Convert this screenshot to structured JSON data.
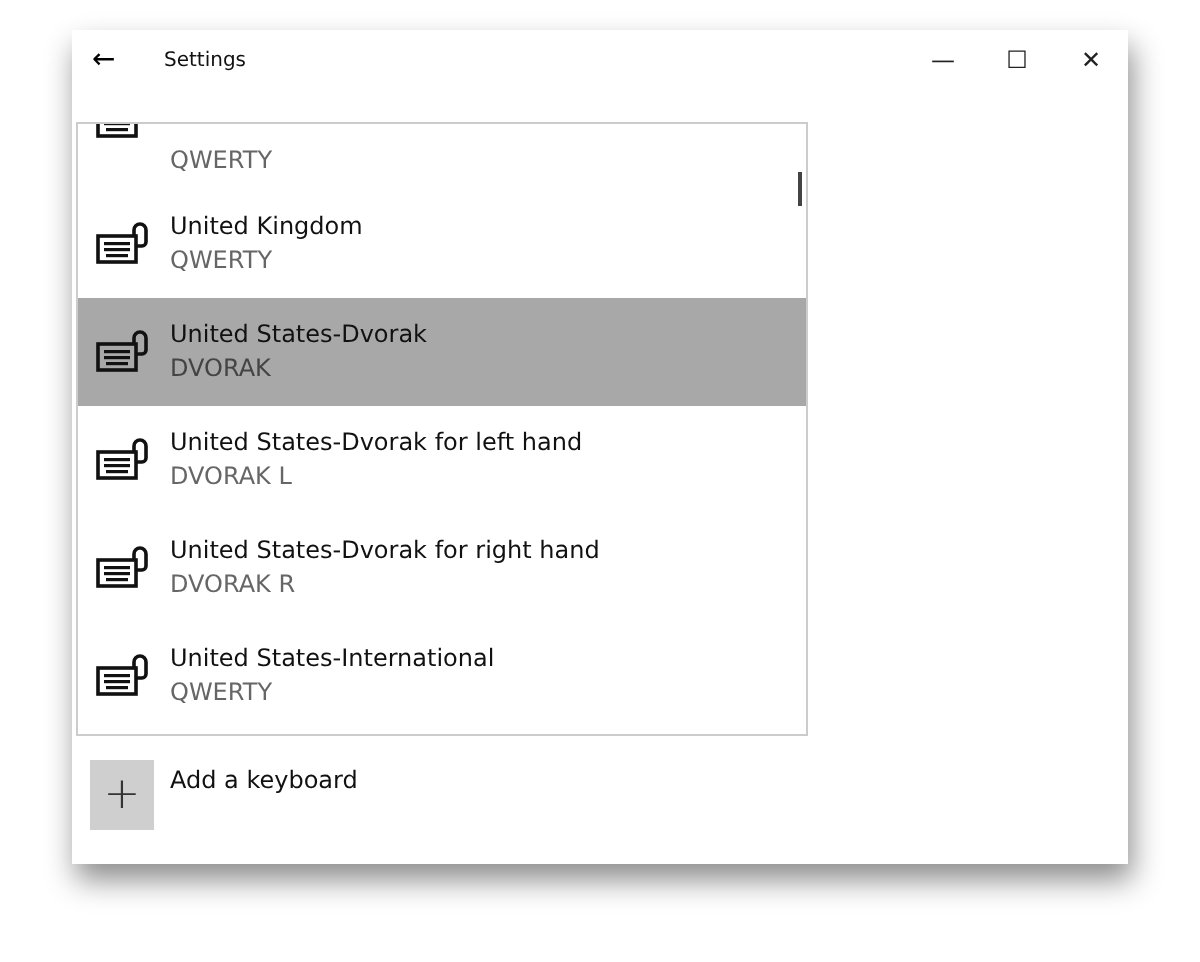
{
  "window": {
    "title": "Settings",
    "back": "←",
    "controls": [
      "—",
      "☐",
      "✕"
    ]
  },
  "keyboards": [
    {
      "subtitle": "QWERTY",
      "selected": false
    },
    {
      "name": "United Kingdom",
      "subtitle": "QWERTY",
      "selected": false
    },
    {
      "name": "United States-Dvorak",
      "subtitle": "DVORAK",
      "selected": true
    },
    {
      "name": "United States-Dvorak for left hand",
      "subtitle": "DVORAK L",
      "selected": false
    },
    {
      "name": "United States-Dvorak for right hand",
      "subtitle": "DVORAK R",
      "selected": false
    },
    {
      "name": "United States-International",
      "subtitle": "QWERTY",
      "selected": false
    }
  ],
  "add_button": {
    "icon": "+",
    "label": "Add a keyboard"
  }
}
